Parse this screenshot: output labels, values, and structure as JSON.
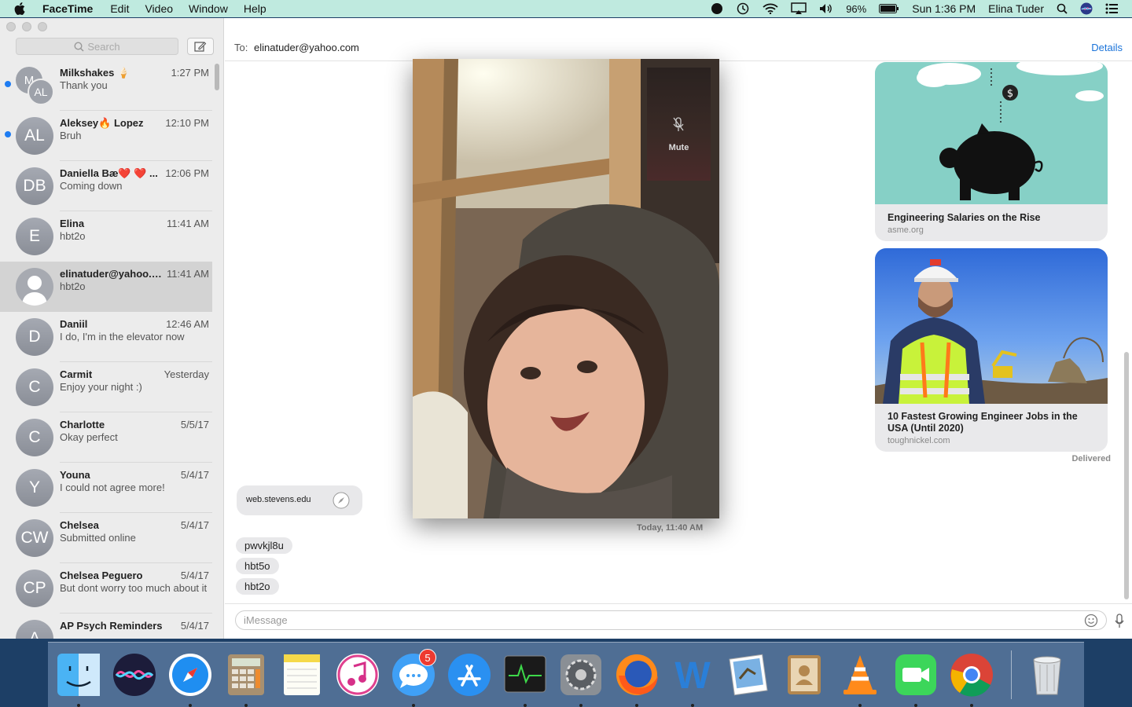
{
  "menubar": {
    "app_name": "FaceTime",
    "menus": [
      "Edit",
      "Video",
      "Window",
      "Help"
    ],
    "battery": "96%",
    "datetime": "Sun 1:36 PM",
    "user": "Elina Tuder"
  },
  "sidebar": {
    "search_placeholder": "Search",
    "conversations": [
      {
        "initials": "M",
        "initials2": "AL",
        "name": "Milkshakes 🍦",
        "time": "1:27 PM",
        "preview": "Thank you",
        "unread": true,
        "group": true
      },
      {
        "initials": "AL",
        "name": "Aleksey🔥 Lopez",
        "time": "12:10 PM",
        "preview": "Bruh",
        "unread": true
      },
      {
        "initials": "DB",
        "name": "Daniella Bæ❤️ ❤️ ...",
        "time": "12:06 PM",
        "preview": "Coming down"
      },
      {
        "initials": "E",
        "name": "Elina",
        "time": "11:41 AM",
        "preview": "hbt2o"
      },
      {
        "initials": "",
        "name": "elinatuder@yahoo.c...",
        "time": "11:41 AM",
        "preview": "hbt2o",
        "selected": true,
        "person": true
      },
      {
        "initials": "D",
        "name": "Daniil",
        "time": "12:46 AM",
        "preview": "I do, I'm in the elevator now"
      },
      {
        "initials": "C",
        "name": "Carmit",
        "time": "Yesterday",
        "preview": "Enjoy your night :)"
      },
      {
        "initials": "C",
        "name": "Charlotte",
        "time": "5/5/17",
        "preview": "Okay perfect"
      },
      {
        "initials": "Y",
        "name": "Youna",
        "time": "5/4/17",
        "preview": "I could not agree more!"
      },
      {
        "initials": "CW",
        "name": "Chelsea",
        "time": "5/4/17",
        "preview": "Submitted online"
      },
      {
        "initials": "CP",
        "name": "Chelsea Peguero",
        "time": "5/4/17",
        "preview": "But dont worry too much about it"
      },
      {
        "initials": "A",
        "name": "AP Psych Reminders",
        "time": "5/4/17",
        "preview": ""
      }
    ]
  },
  "main": {
    "to_label": "To:",
    "to_value": "elinatuder@yahoo.com",
    "details": "Details",
    "cards": [
      {
        "title": "Engineering Salaries on the Rise",
        "domain": "asme.org"
      },
      {
        "title": "10 Fastest Growing Engineer Jobs in the USA (Until 2020)",
        "domain": "toughnickel.com"
      }
    ],
    "delivered": "Delivered",
    "link_bubble": "web.stevens.edu",
    "timestamp": "Today, 11:40 AM",
    "messages": [
      "pwvkjl8u",
      "hbt5o",
      "hbt2o"
    ],
    "input_placeholder": "iMessage"
  },
  "video": {
    "pip_label": "Mute"
  },
  "dock": {
    "items": [
      "finder-icon",
      "siri-icon",
      "safari-icon",
      "calculator-icon",
      "notes-icon",
      "itunes-icon",
      "messages-icon",
      "app-store-icon",
      "activity-monitor-icon",
      "system-preferences-icon",
      "firefox-icon",
      "word-icon",
      "preview-icon",
      "contacts-icon",
      "vlc-icon",
      "facetime-icon",
      "chrome-icon",
      "trash-icon"
    ],
    "messages_badge": "5"
  }
}
